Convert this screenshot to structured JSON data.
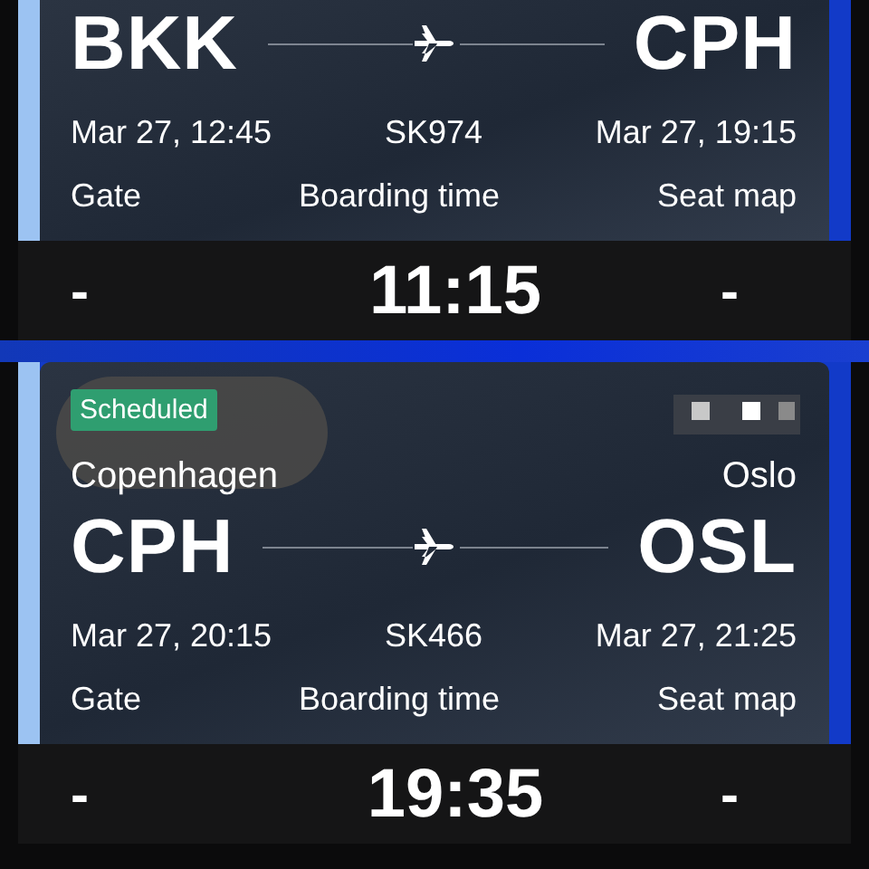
{
  "flights": [
    {
      "origin": {
        "code": "BKK"
      },
      "destination": {
        "code": "CPH"
      },
      "departure": "Mar 27, 12:45",
      "flight_number": "SK974",
      "arrival": "Mar 27, 19:15",
      "labels": [
        "Gate",
        "Boarding time",
        "Seat map"
      ],
      "values": [
        "-",
        "11:15",
        "-"
      ]
    },
    {
      "status": "Scheduled",
      "origin": {
        "city": "Copenhagen",
        "code": "CPH"
      },
      "destination": {
        "city": "Oslo",
        "code": "OSL"
      },
      "departure": "Mar 27, 20:15",
      "flight_number": "SK466",
      "arrival": "Mar 27, 21:25",
      "labels": [
        "Gate",
        "Boarding time",
        "Seat map"
      ],
      "values": [
        "-",
        "19:35",
        "-"
      ]
    }
  ]
}
